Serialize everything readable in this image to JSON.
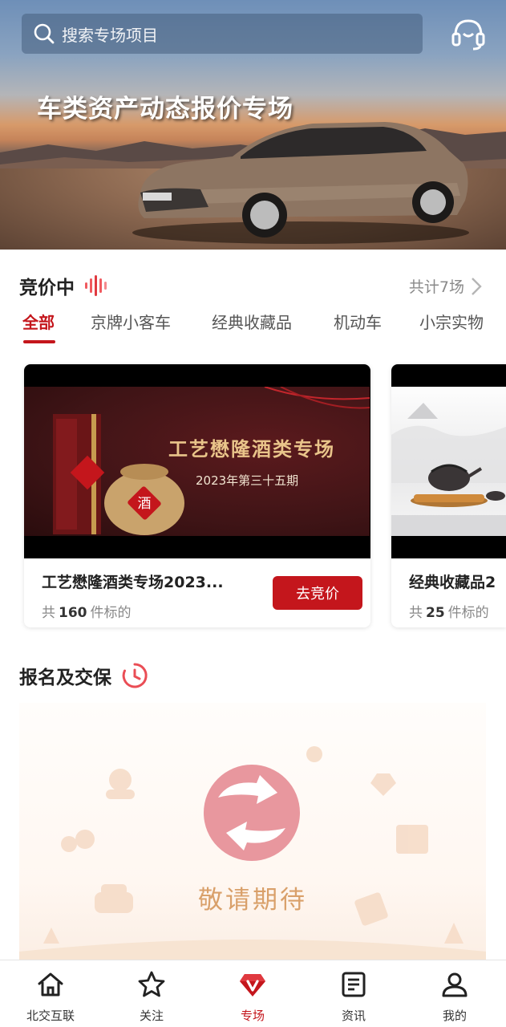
{
  "search": {
    "placeholder": "搜索专场项目",
    "icon": "search-icon"
  },
  "header": {
    "support_icon": "headset-icon"
  },
  "banner": {
    "title": "车类资产动态报价专场"
  },
  "bidding": {
    "title": "竞价中",
    "total": "共计7场",
    "tabs": [
      {
        "label": "全部",
        "active": true
      },
      {
        "label": "京牌小客车",
        "active": false
      },
      {
        "label": "经典收藏品",
        "active": false
      },
      {
        "label": "机动车",
        "active": false
      },
      {
        "label": "小宗实物",
        "active": false
      }
    ],
    "cards": [
      {
        "title": "工艺懋隆酒类专场2023...",
        "count_prefix": "共",
        "count": "160",
        "count_suffix": "件标的",
        "button": "去竞价",
        "poster_title": "工艺懋隆酒类专场",
        "poster_subtitle": "2023年第三十五期",
        "poster_badge": "酒"
      },
      {
        "title": "经典收藏品2",
        "count_prefix": "共",
        "count": "25",
        "count_suffix": "件标的"
      }
    ]
  },
  "registration": {
    "title": "报名及交保",
    "coming_soon": "敬请期待"
  },
  "bottom_nav": [
    {
      "label": "北交互联",
      "icon": "home-icon",
      "active": false
    },
    {
      "label": "关注",
      "icon": "star-icon",
      "active": false
    },
    {
      "label": "专场",
      "icon": "gem-v-icon",
      "active": true
    },
    {
      "label": "资讯",
      "icon": "news-icon",
      "active": false
    },
    {
      "label": "我的",
      "icon": "user-icon",
      "active": false
    }
  ],
  "colors": {
    "accent": "#c4161c",
    "coming_soon_text": "#d9a06a"
  }
}
